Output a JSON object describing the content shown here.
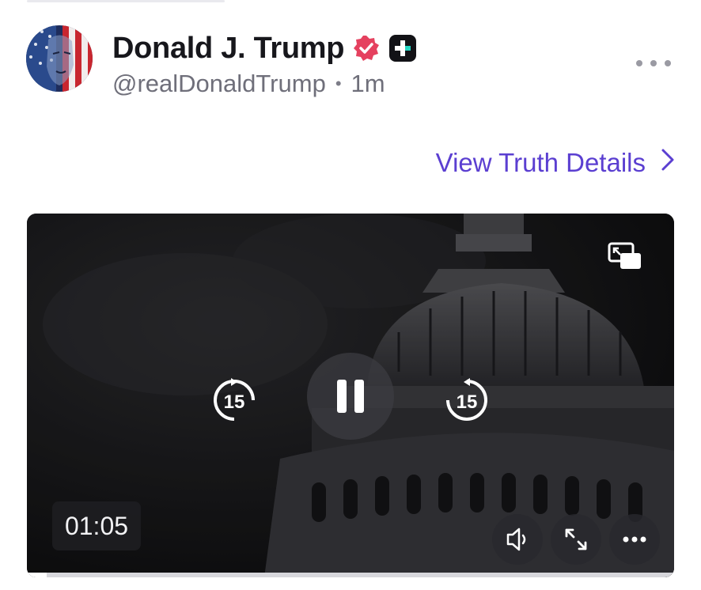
{
  "post": {
    "author": {
      "display_name": "Donald J. Trump",
      "handle": "@realDonaldTrump",
      "time_ago": "1m",
      "separator": "•"
    },
    "view_details_label": "View Truth Details"
  },
  "video": {
    "rewind_seconds": "15",
    "forward_seconds": "15",
    "elapsed_time": "01:05",
    "progress_fraction": 0.03,
    "state": "playing"
  },
  "colors": {
    "accent": "#5b3fd1",
    "verified": "#e5415f"
  },
  "icons": [
    "verified-badge-icon",
    "plus-badge-icon",
    "more-icon",
    "chevron-right-icon",
    "pip-icon",
    "rewind-15-icon",
    "pause-icon",
    "forward-15-icon",
    "volume-icon",
    "fullscreen-icon",
    "video-more-icon"
  ]
}
